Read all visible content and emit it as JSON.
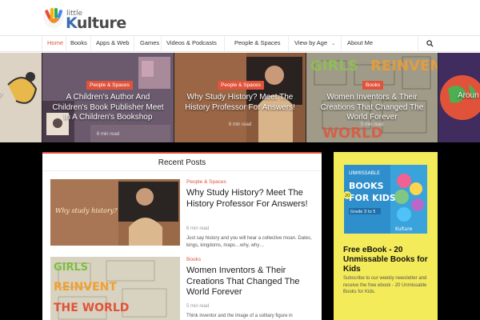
{
  "brand": {
    "logo_small": "little",
    "logo_big_a": "K",
    "logo_big_b": "ulture"
  },
  "nav": {
    "items": [
      "Home",
      "Books",
      "Apps & Web",
      "Games",
      "Videos & Podcasts",
      "People & Spaces",
      "View by Age",
      "About Me"
    ]
  },
  "slider": [
    {
      "text": "?"
    },
    {
      "badge": "People & Spaces",
      "title": "A Children's Author And Children's Book Publisher Meet In A Children's Bookshop",
      "meta": "6 min read"
    },
    {
      "badge": "People & Spaces",
      "title": "Why Study History? Meet The History Professor For Answers!",
      "meta": "6 min read"
    },
    {
      "badge": "Books",
      "title": "Women Inventors & Their Creations That Changed The World Forever",
      "meta": "5 min read"
    },
    {
      "text": "Aroun"
    }
  ],
  "recent": {
    "heading": "Recent Posts",
    "posts": [
      {
        "category": "People & Spaces",
        "title": "Why Study History? Meet The History Professor For Answers!",
        "meta": "6 min read",
        "excerpt": "Just say history and you will hear a collective moan. Dates, kings, kingdoms, maps…why, why…",
        "thumb_caption": "Why study history?"
      },
      {
        "category": "Books",
        "title": "Women Inventors & Their Creations That Changed The World Forever",
        "meta": "5 min read",
        "excerpt": "Think inventor and the image of a solitary figure in",
        "thumb_lines": [
          "GIRLS",
          "REINVENT",
          "THE WORLD"
        ]
      }
    ]
  },
  "sidebar": {
    "cover_top": "UNMISSABLE",
    "cover_main": "BOOKS FOR KIDS",
    "cover_badge": "20",
    "cover_grade": "Grade 3 to 5",
    "cover_brand": "Kulture",
    "headline": "Free eBook - 20 Unmissable Books for Kids",
    "desc": "Subscribe to our weekly newsletter and receive the free ebook - 20 Unmissable Books for Kids."
  },
  "colors": {
    "accent": "#e0533a",
    "nav_text": "#333333",
    "ebook_bg": "#f4eb5a"
  }
}
